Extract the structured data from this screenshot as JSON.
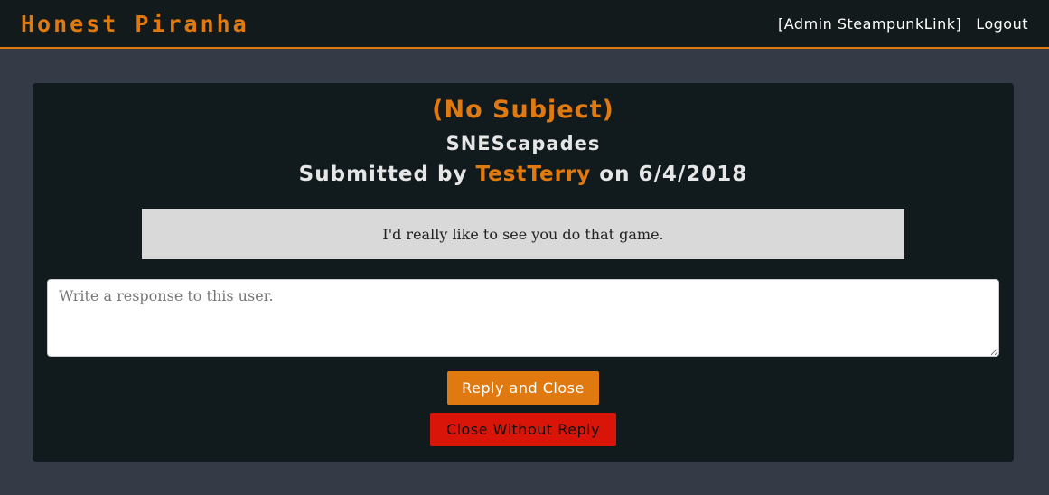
{
  "navbar": {
    "brand": "Honest Piranha",
    "admin_link": "[Admin SteampunkLink]",
    "logout_link": "Logout"
  },
  "ticket": {
    "subject": "(No Subject)",
    "game": "SNEScapades",
    "submitted_prefix": "Submitted by ",
    "submitted_user": "TestTerry",
    "submitted_suffix": " on 6/4/2018",
    "message": "I'd really like to see you do that game."
  },
  "response": {
    "placeholder": "Write a response to this user.",
    "value": ""
  },
  "actions": {
    "reply_label": "Reply and Close",
    "close_label": "Close Without Reply"
  },
  "colors": {
    "accent": "#e07a10",
    "danger": "#d91408",
    "navbar_bg": "#121a1c",
    "page_bg": "#343a46",
    "panel_bg": "#111a1c"
  }
}
